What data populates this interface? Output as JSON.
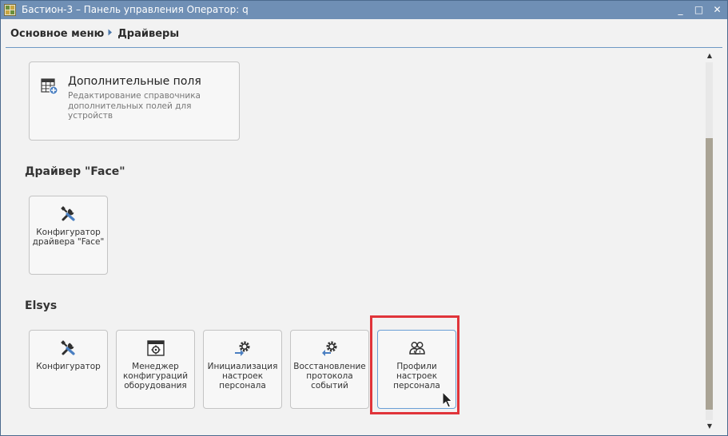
{
  "window": {
    "title": "Бастион-3 – Панель управления Оператор: q",
    "minimize_label": "_",
    "maximize_label": "□",
    "close_label": "✕"
  },
  "breadcrumb": {
    "root": "Основное меню",
    "current": "Драйверы"
  },
  "sections": {
    "extra_fields": {
      "title": "Дополнительные поля",
      "description": "Редактирование справочника дополнительных полей для устройств",
      "icon": "table-add-icon"
    },
    "face": {
      "title": "Драйвер \"Face\"",
      "items": [
        {
          "label": "Конфигуратор драйвера \"Face\"",
          "icon": "tools-icon"
        }
      ]
    },
    "elsys": {
      "title": "Elsys",
      "items": [
        {
          "label": "Конфигуратор",
          "icon": "tools-icon"
        },
        {
          "label": "Менеджер конфигураций оборудования",
          "icon": "config-window-icon"
        },
        {
          "label": "Инициализация настроек персонала",
          "icon": "gear-arrow-right-icon"
        },
        {
          "label": "Восстановление протокола событий",
          "icon": "gear-arrow-left-icon"
        },
        {
          "label": "Профили настроек персонала",
          "icon": "users-icon"
        }
      ]
    }
  },
  "colors": {
    "titlebar": "#6f8fb5",
    "accent_line": "#6e99c4",
    "highlight_frame": "#e0343a",
    "selected_tile_border": "#6b9fd6"
  }
}
